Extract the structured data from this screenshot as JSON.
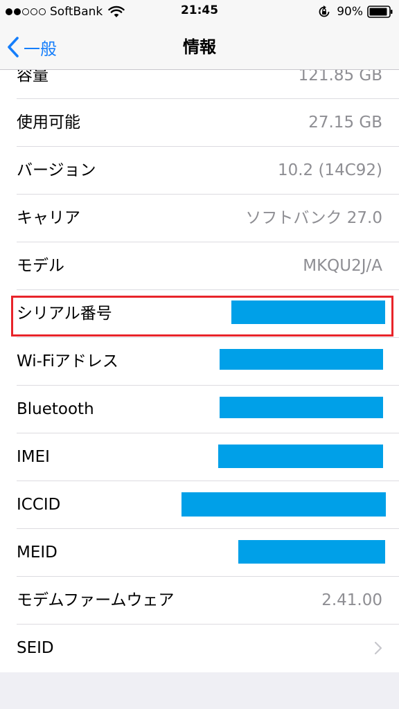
{
  "status_bar": {
    "carrier": "SoftBank",
    "time": "21:45",
    "battery": "90%",
    "signal_dots_filled": 2,
    "signal_dots_total": 5
  },
  "nav": {
    "back_label": "一般",
    "title": "情報"
  },
  "rows": [
    {
      "label": "容量",
      "value": "121.85 GB"
    },
    {
      "label": "使用可能",
      "value": "27.15 GB"
    },
    {
      "label": "バージョン",
      "value": "10.2 (14C92)"
    },
    {
      "label": "キャリア",
      "value": "ソフトバンク 27.0"
    },
    {
      "label": "モデル",
      "value": "MKQU2J/A"
    },
    {
      "label": "シリアル番号",
      "value": ""
    },
    {
      "label": "Wi-Fiアドレス",
      "value": ""
    },
    {
      "label": "Bluetooth",
      "value": ""
    },
    {
      "label": "IMEI",
      "value": ""
    },
    {
      "label": "ICCID",
      "value": ""
    },
    {
      "label": "MEID",
      "value": ""
    },
    {
      "label": "モデムファームウェア",
      "value": "2.41.00"
    },
    {
      "label": "SEID",
      "value": ""
    }
  ],
  "colors": {
    "accent": "#157efb",
    "redaction": "#00a0e8",
    "highlight": "#e8242a"
  }
}
